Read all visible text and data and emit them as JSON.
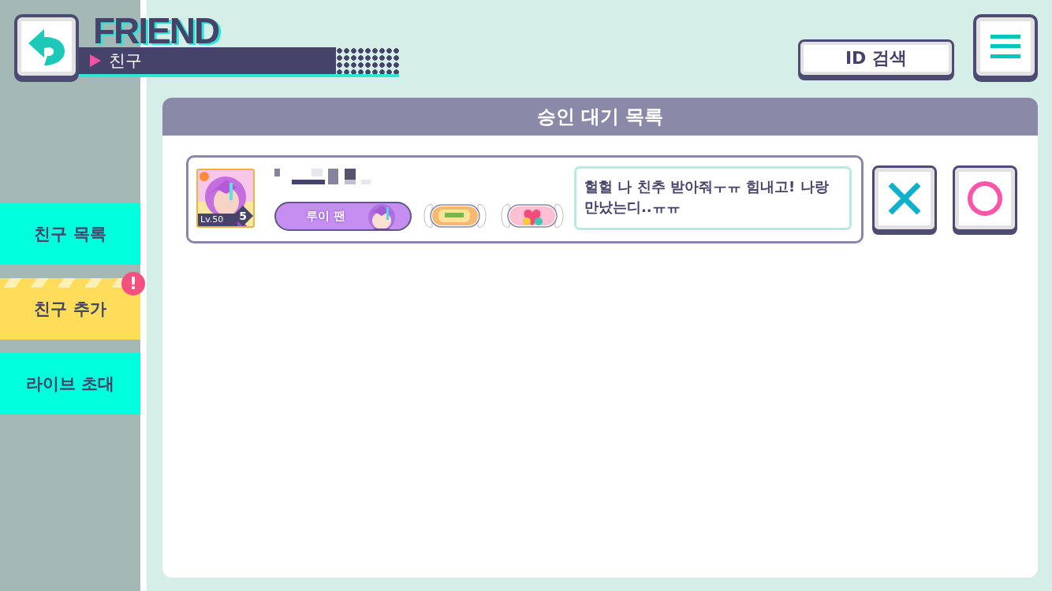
{
  "header": {
    "title": "FRIEND",
    "subtitle": "친구",
    "search_button": "ID 검색"
  },
  "sidebar": {
    "items": [
      {
        "label": "친구 목록",
        "selected": false
      },
      {
        "label": "친구 추가",
        "selected": true,
        "badge": "!"
      },
      {
        "label": "라이브 초대",
        "selected": false
      }
    ]
  },
  "panel": {
    "title": "승인 대기 목록",
    "requests": [
      {
        "card_level": "Lv.50",
        "card_rank": "5",
        "fan_badge": "루이 팬",
        "message": "헐헐 나 친추 받아줘ㅜㅠ 힘내고! 나랑 만났는디..ㅠㅠ"
      }
    ]
  }
}
